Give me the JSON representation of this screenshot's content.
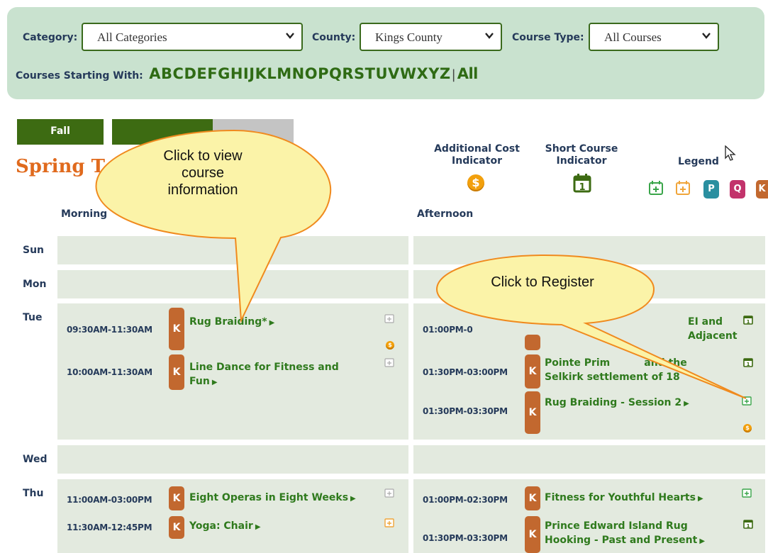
{
  "filters": {
    "category_label": "Category:",
    "category_value": "All Categories",
    "county_label": "County:",
    "county_value": "Kings County",
    "course_type_label": "Course Type:",
    "course_type_value": "All Courses",
    "letters_label": "Courses Starting With:",
    "letters": [
      "A",
      "B",
      "C",
      "D",
      "E",
      "F",
      "G",
      "H",
      "I",
      "J",
      "K",
      "L",
      "M",
      "N",
      "O",
      "P",
      "Q",
      "R",
      "S",
      "T",
      "U",
      "V",
      "W",
      "X",
      "Y",
      "Z"
    ],
    "separator": "|",
    "all_label": "All"
  },
  "tabs": {
    "fall": "Fall",
    "term_title": "Spring T"
  },
  "indicators": {
    "additional_cost": "Additional Cost Indicator",
    "short_course": "Short Course Indicator",
    "legend": "Legend",
    "coin_symbol": "$",
    "short_course_number": "1",
    "legend_badges": [
      "P",
      "Q",
      "K"
    ]
  },
  "columns": {
    "morning": "Morning",
    "afternoon": "Afternoon"
  },
  "days": {
    "sun": "Sun",
    "mon": "Mon",
    "tue": "Tue",
    "wed": "Wed",
    "thu": "Thu"
  },
  "courses": {
    "badge": "K",
    "tue_m1_time": "09:30AM-11:30AM",
    "tue_m1_title": "Rug Braiding*",
    "tue_m2_time": "10:00AM-11:30AM",
    "tue_m2_title_line1": "Line Dance for Fitness and",
    "tue_m2_title_line2": "Fun",
    "tue_a1_time": "01:00PM-0",
    "tue_a1_title_fragment": "EI and Adjacent",
    "tue_a2_time": "01:30PM-03:00PM",
    "tue_a2_title_line1": "Pointe Prim",
    "tue_a2_title_line1b": "and the",
    "tue_a2_title_line2": "Selkirk settlement of 18",
    "tue_a3_time": "01:30PM-03:30PM",
    "tue_a3_title": "Rug Braiding - Session 2",
    "thu_m1_time": "11:00AM-03:00PM",
    "thu_m1_title": "Eight Operas in Eight Weeks",
    "thu_m2_time": "11:30AM-12:45PM",
    "thu_m2_title": "Yoga: Chair",
    "thu_a1_time": "01:00PM-02:30PM",
    "thu_a1_title": "Fitness for Youthful Hearts",
    "thu_a2_time": "01:30PM-03:30PM",
    "thu_a2_title_line1": "Prince Edward Island Rug",
    "thu_a2_title_line2": "Hooking - Past and Present"
  },
  "callouts": {
    "view_info": "Click to view course information",
    "view_info_l1": "Click to view",
    "view_info_l2": "course",
    "view_info_l3": "information",
    "register": "Click to Register"
  },
  "colors": {
    "panel": "#c9e2cf",
    "green_dark": "#3d6b12",
    "course_green": "#2f7a1d",
    "k_badge": "#c2682f",
    "p_badge": "#2a8fa0",
    "q_badge": "#c2336b",
    "title_orange": "#e06a1d",
    "callout_fill": "#fbf3a8",
    "callout_stroke": "#f08a1e"
  }
}
